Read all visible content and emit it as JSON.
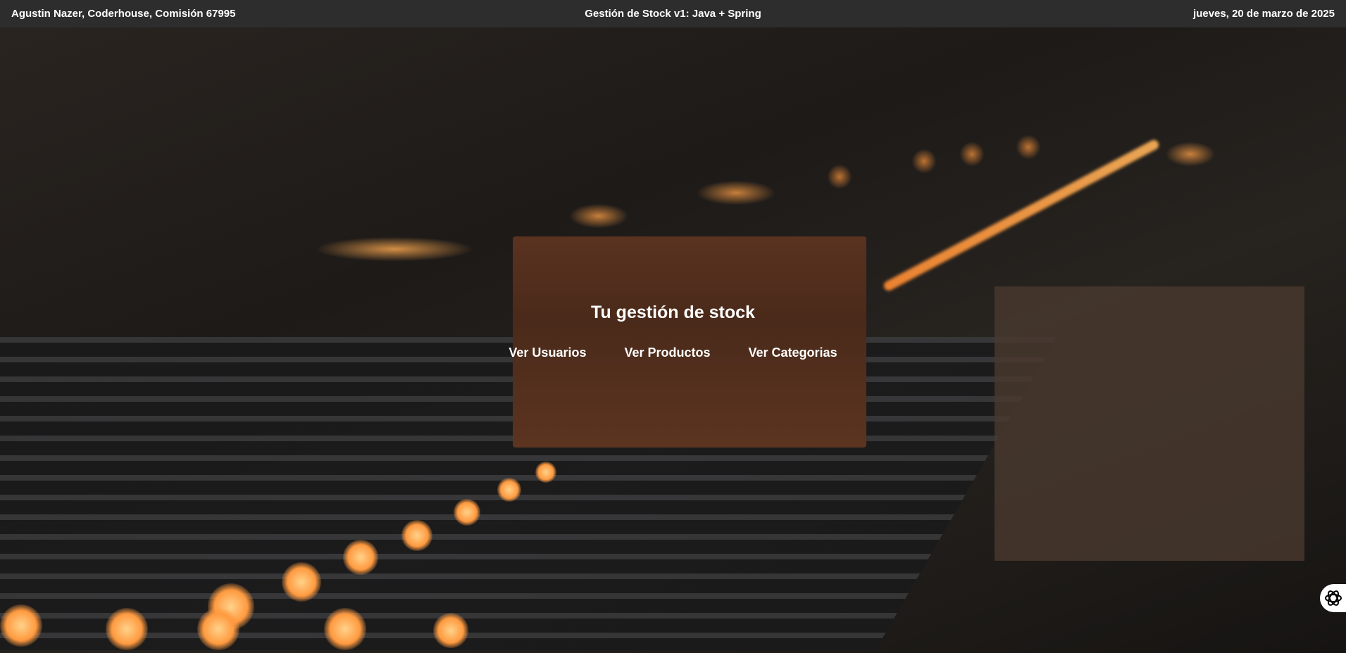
{
  "header": {
    "left": "Agustin Nazer, Coderhouse, Comisión 67995",
    "center": "Gestión de Stock v1: Java + Spring",
    "right": "jueves, 20 de marzo de 2025"
  },
  "main": {
    "title": "Tu gestión de stock",
    "links": [
      {
        "label": "Ver Usuarios"
      },
      {
        "label": "Ver Productos"
      },
      {
        "label": "Ver Categorias"
      }
    ]
  },
  "widget": {
    "icon": "openai-logo-icon"
  }
}
